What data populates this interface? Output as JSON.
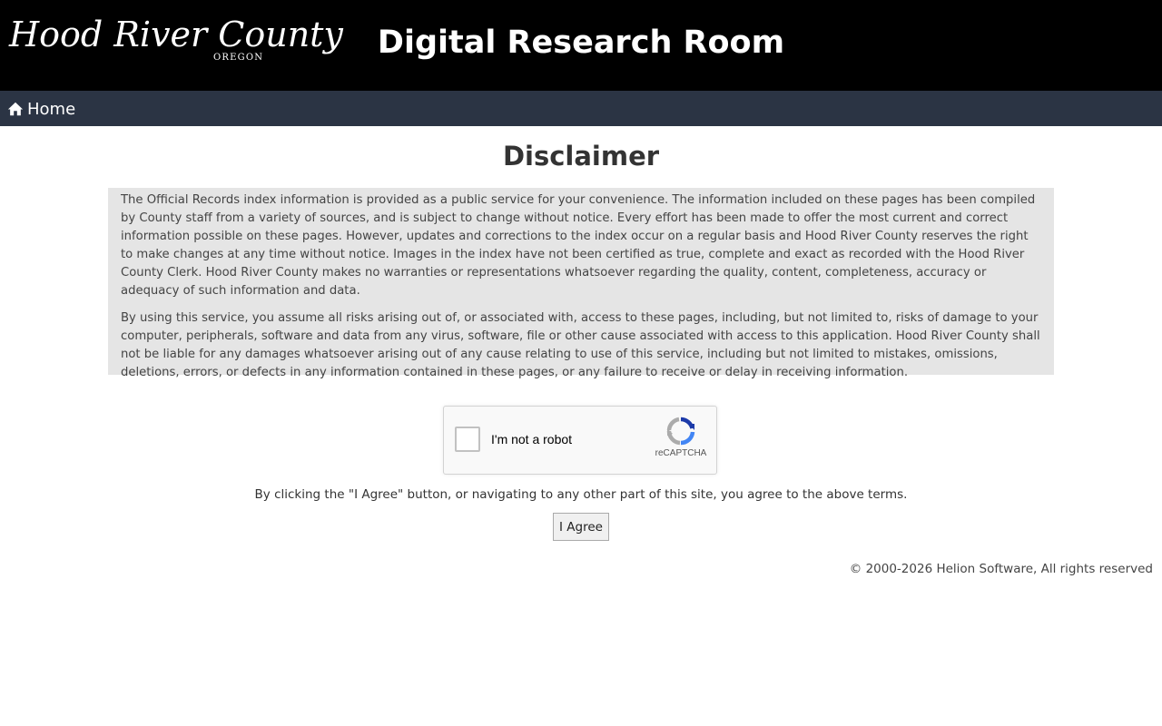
{
  "header": {
    "logo_script": "Hood River County",
    "logo_sub": "OREGON",
    "site_title": "Digital Research Room"
  },
  "nav": {
    "home_label": "Home",
    "home_icon": "home-icon"
  },
  "main": {
    "heading": "Disclaimer",
    "paragraphs": [
      "The Official Records index information is provided as a public service for your convenience. The information included on these pages has been compiled by County staff from a variety of sources, and is subject to change without notice. Every effort has been made to offer the most current and correct information possible on these pages. However, updates and corrections to the index occur on a regular basis and Hood River County reserves the right to make changes at any time without notice. Images in the index have not been certified as true, complete and exact as recorded with the Hood River County Clerk. Hood River County makes no warranties or representations whatsoever regarding the quality, content, completeness, accuracy or adequacy of such information and data.",
      "By using this service, you assume all risks arising out of, or associated with, access to these pages, including, but not limited to, risks of damage to your computer, peripherals, software and data from any virus, software, file or other cause associated with access to this application. Hood River County shall not be liable for any damages whatsoever arising out of any cause relating to use of this service, including but not limited to mistakes, omissions, deletions, errors, or defects in any information contained in these pages, or any failure to receive or delay in receiving information."
    ],
    "captcha": {
      "label": "I'm not a robot",
      "brand": "reCAPTCHA",
      "checked": false
    },
    "terms_note": "By clicking the \"I Agree\" button, or navigating to any other part of this site, you agree to the above terms.",
    "agree_label": "I Agree"
  },
  "footer": {
    "copyright": "© 2000-2026 Helion Software, All rights reserved"
  },
  "colors": {
    "header_bg": "#000000",
    "nav_bg": "#2b3444",
    "disclaimer_bg": "#e5e5e5"
  }
}
